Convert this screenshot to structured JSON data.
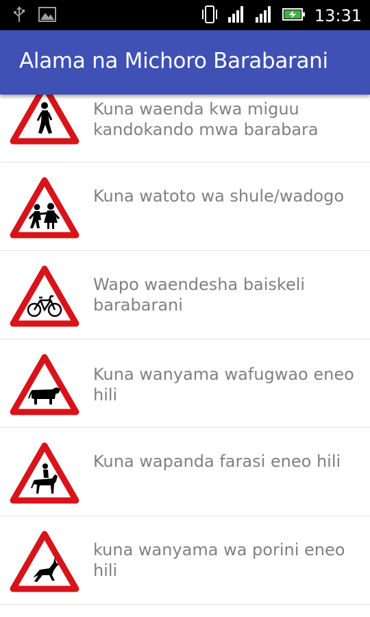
{
  "status_bar": {
    "time": "13:31",
    "icons": [
      "usb-icon",
      "image-icon",
      "vibrate-icon",
      "signal-icon",
      "signal-icon",
      "battery-charging-icon"
    ]
  },
  "app_bar": {
    "title": "Alama na Michoro Barabarani"
  },
  "signs": [
    {
      "icon": "pedestrian-warning-sign-icon",
      "label": "Kuna waenda kwa miguu kandokando mwa barabara"
    },
    {
      "icon": "school-children-warning-sign-icon",
      "label": "Kuna watoto wa shule/wadogo"
    },
    {
      "icon": "cyclist-warning-sign-icon",
      "label": "Wapo waendesha baiskeli barabarani"
    },
    {
      "icon": "cattle-warning-sign-icon",
      "label": "Kuna wanyama wafugwao eneo hili"
    },
    {
      "icon": "horse-rider-warning-sign-icon",
      "label": "Kuna wapanda farasi eneo hili"
    },
    {
      "icon": "wild-animal-warning-sign-icon",
      "label": "kuna wanyama wa porini eneo hili"
    }
  ],
  "colors": {
    "app_bar": "#3f51b5",
    "sign_border": "#d7141a",
    "text": "#808080"
  }
}
